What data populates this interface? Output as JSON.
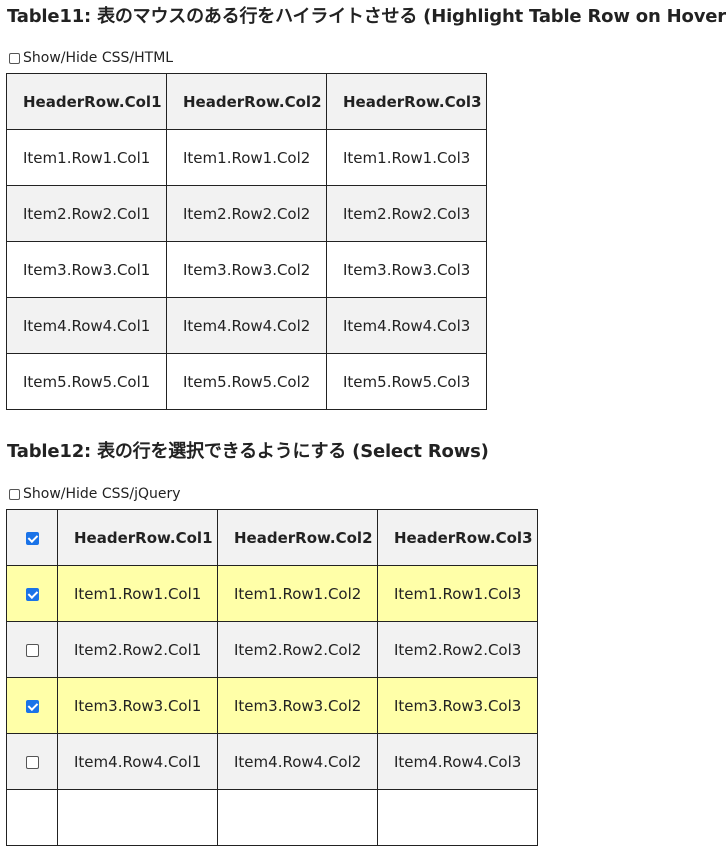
{
  "table11": {
    "title": "Table11: 表のマウスのある行をハイライトさせる (Highlight Table Row on Hover)",
    "toggle_label": "Show/Hide CSS/HTML",
    "headers": [
      "HeaderRow.Col1",
      "HeaderRow.Col2",
      "HeaderRow.Col3"
    ],
    "rows": [
      [
        "Item1.Row1.Col1",
        "Item1.Row1.Col2",
        "Item1.Row1.Col3"
      ],
      [
        "Item2.Row2.Col1",
        "Item2.Row2.Col2",
        "Item2.Row2.Col3"
      ],
      [
        "Item3.Row3.Col1",
        "Item3.Row3.Col2",
        "Item3.Row3.Col3"
      ],
      [
        "Item4.Row4.Col1",
        "Item4.Row4.Col2",
        "Item4.Row4.Col3"
      ],
      [
        "Item5.Row5.Col1",
        "Item5.Row5.Col2",
        "Item5.Row5.Col3"
      ]
    ]
  },
  "table12": {
    "title": "Table12: 表の行を選択できるようにする (Select Rows)",
    "toggle_label": "Show/Hide CSS/jQuery",
    "header_checked": true,
    "headers": [
      "HeaderRow.Col1",
      "HeaderRow.Col2",
      "HeaderRow.Col3"
    ],
    "rows": [
      {
        "checked": true,
        "cells": [
          "Item1.Row1.Col1",
          "Item1.Row1.Col2",
          "Item1.Row1.Col3"
        ]
      },
      {
        "checked": false,
        "cells": [
          "Item2.Row2.Col1",
          "Item2.Row2.Col2",
          "Item2.Row2.Col3"
        ]
      },
      {
        "checked": true,
        "cells": [
          "Item3.Row3.Col1",
          "Item3.Row3.Col2",
          "Item3.Row3.Col3"
        ]
      },
      {
        "checked": false,
        "cells": [
          "Item4.Row4.Col1",
          "Item4.Row4.Col2",
          "Item4.Row4.Col3"
        ]
      }
    ]
  },
  "colors": {
    "stripe": "#f2f2f2",
    "selected": "#ffffa8",
    "checkbox_checked": "#1a73e8",
    "border": "#222222"
  }
}
